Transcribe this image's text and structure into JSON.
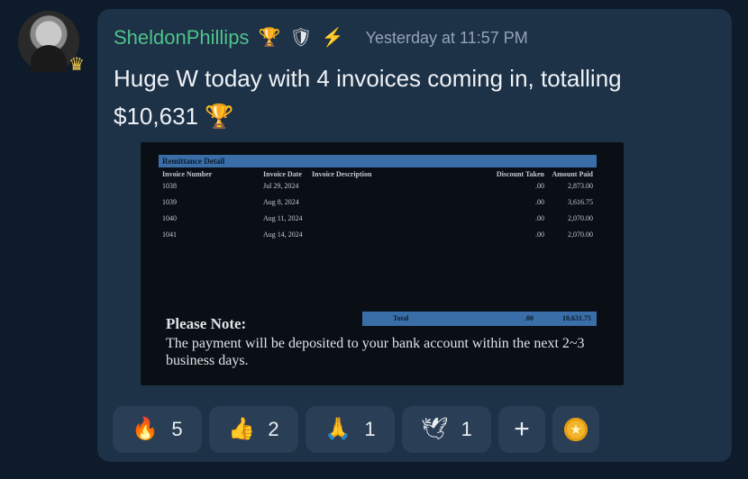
{
  "user": {
    "name": "SheldonPhillips",
    "badges": [
      "🏆",
      "🛡",
      "⚡"
    ],
    "avatar_badge": "♛"
  },
  "message": {
    "timestamp": "Yesterday at 11:57 PM",
    "text": "Huge W today with 4 invoices coming in, totalling $10,631 🏆"
  },
  "document": {
    "title": "Remittance Detail",
    "columns": [
      "Invoice Number",
      "Invoice Date",
      "Invoice Description",
      "Discount Taken",
      "Amount Paid"
    ],
    "rows": [
      {
        "number": "1038",
        "date": "Jul 29, 2024",
        "description": "",
        "discount": ".00",
        "amount": "2,873.00"
      },
      {
        "number": "1039",
        "date": "Aug 8, 2024",
        "description": "",
        "discount": ".00",
        "amount": "3,616.75"
      },
      {
        "number": "1040",
        "date": "Aug 11, 2024",
        "description": "",
        "discount": ".00",
        "amount": "2,070.00"
      },
      {
        "number": "1041",
        "date": "Aug 14, 2024",
        "description": "",
        "discount": ".00",
        "amount": "2,070.00"
      }
    ],
    "total_label": "Total",
    "total_discount": ".00",
    "total_amount": "10,631.75",
    "note_title": "Please Note:",
    "note_text": "The payment will be deposited to your bank account within the next 2~3 business days."
  },
  "reactions": [
    {
      "emoji": "🔥",
      "count": "5"
    },
    {
      "emoji": "👍",
      "count": "2"
    },
    {
      "emoji": "🙏",
      "count": "1"
    },
    {
      "emoji": "🕊",
      "count": "1"
    }
  ],
  "add_reaction_label": "+",
  "coin_icon": "★",
  "colors": {
    "username": "#4fc38a",
    "card": "#1d3147",
    "accent_bar": "#3a6ea8"
  }
}
